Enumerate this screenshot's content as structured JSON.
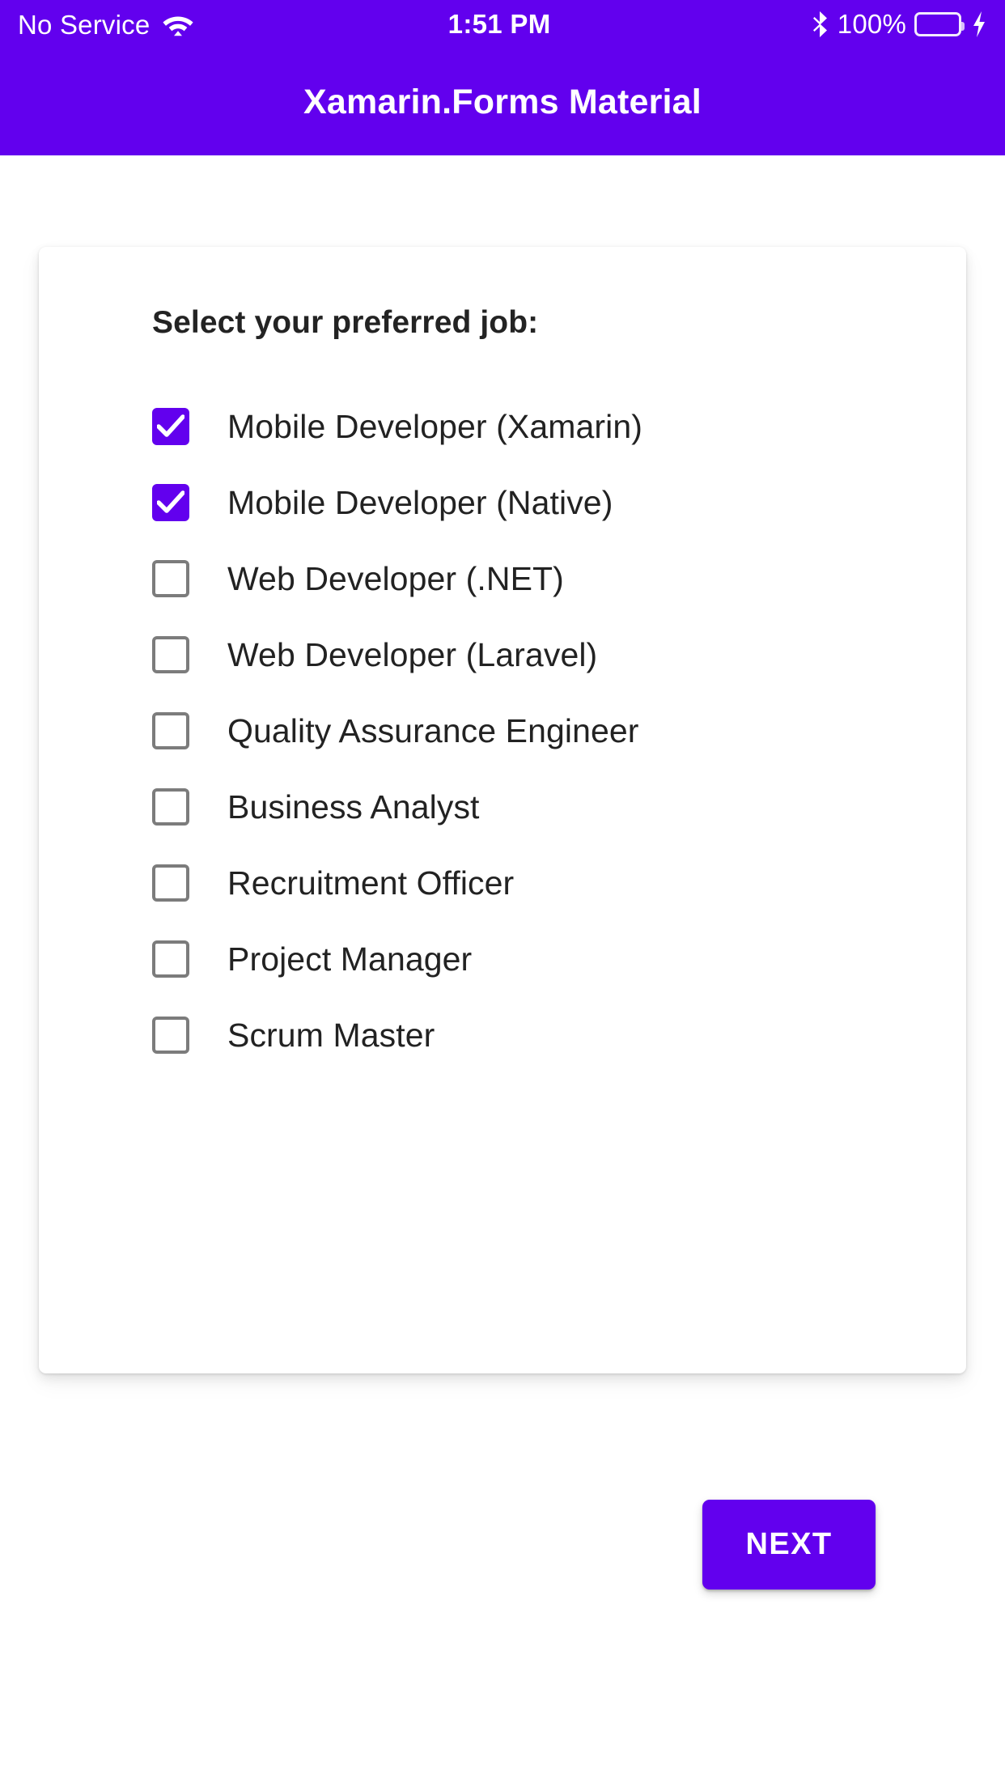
{
  "status_bar": {
    "carrier": "No Service",
    "wifi_icon": "wifi-icon",
    "time": "1:51 PM",
    "bluetooth_icon": "bluetooth-icon",
    "battery_percent": "100%",
    "battery_icon": "battery-full-icon",
    "charging_icon": "lightning-bolt-icon",
    "background_color": "#6200EE"
  },
  "navbar": {
    "title": "Xamarin.Forms Material",
    "background_color": "#6200EE",
    "text_color": "#FFFFFF"
  },
  "card": {
    "heading": "Select your preferred job:",
    "accent_color": "#6200EE",
    "checkbox_off_border": "#7C7C7C",
    "options": [
      {
        "label": "Mobile Developer (Xamarin)",
        "checked": true
      },
      {
        "label": "Mobile Developer (Native)",
        "checked": true
      },
      {
        "label": "Web Developer (.NET)",
        "checked": false
      },
      {
        "label": "Web Developer (Laravel)",
        "checked": false
      },
      {
        "label": "Quality Assurance Engineer",
        "checked": false
      },
      {
        "label": "Business Analyst",
        "checked": false
      },
      {
        "label": "Recruitment Officer",
        "checked": false
      },
      {
        "label": "Project Manager",
        "checked": false
      },
      {
        "label": "Scrum Master",
        "checked": false
      }
    ],
    "next_button_label": "NEXT"
  }
}
